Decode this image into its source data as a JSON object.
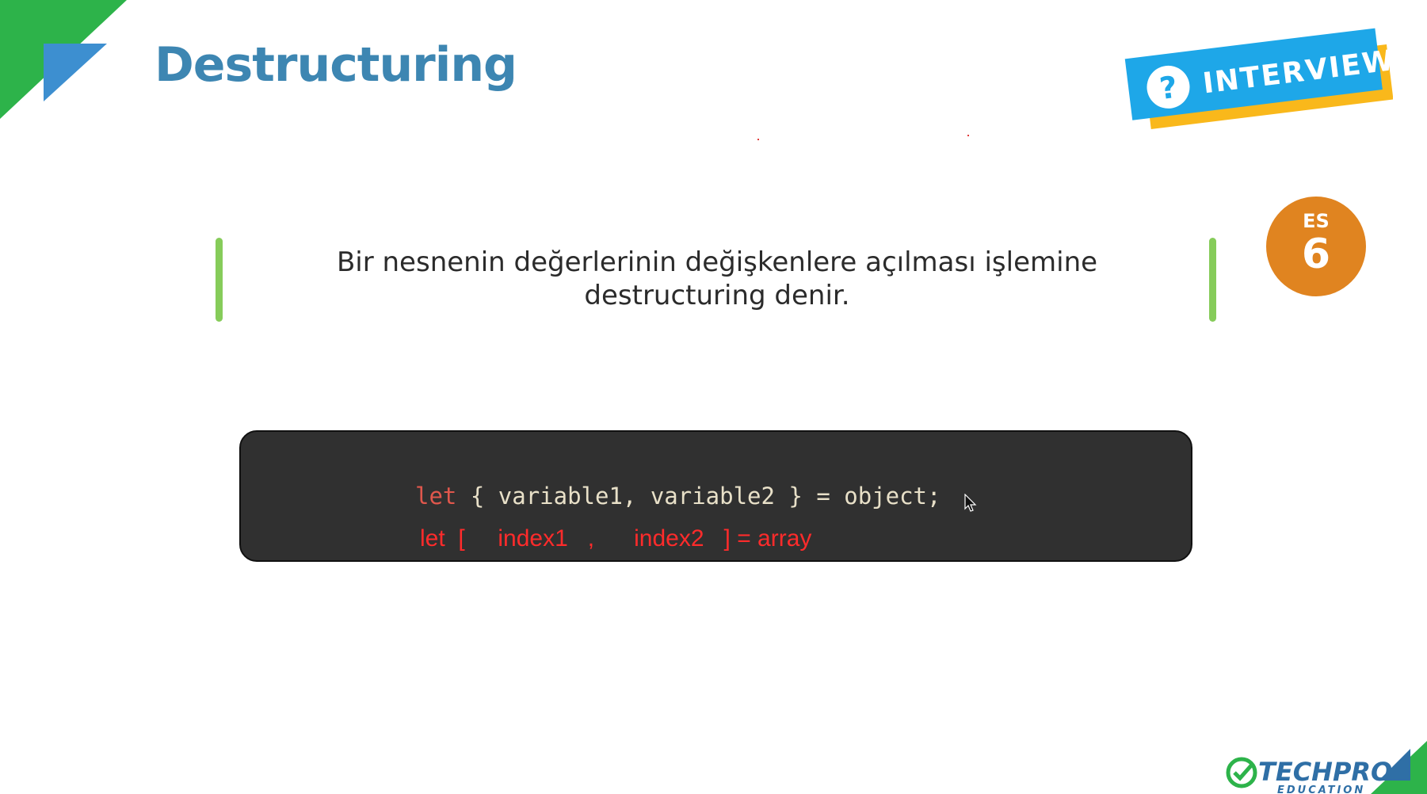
{
  "slide": {
    "title": "Destructuring",
    "badge": {
      "icon": "question-mark-icon",
      "label": "INTERVIEW"
    },
    "es_badge": {
      "top": "ES",
      "number": "6"
    },
    "definition": {
      "line1": "Bir nesnenin değerlerinin değişkenlere açılması işlemine",
      "line2": "destructuring denir."
    },
    "code": {
      "line1": {
        "keyword": "let",
        "rest": " { variable1, variable2 } = object;"
      },
      "line2": "let  [     index1   ,      index2   ] = array"
    },
    "logo": {
      "name": "TECHPRO",
      "sub": "EDUCATION"
    }
  },
  "colors": {
    "title": "#3d86b2",
    "green": "#2db34a",
    "blue": "#3d8fd0",
    "accent_bar": "#86cc5a",
    "es_badge": "#e08420",
    "code_bg": "#303030",
    "code_keyword": "#e0574c",
    "code_red": "#ff2b2b",
    "interview_blue": "#1ea7e8",
    "interview_yellow": "#f9b81b"
  }
}
